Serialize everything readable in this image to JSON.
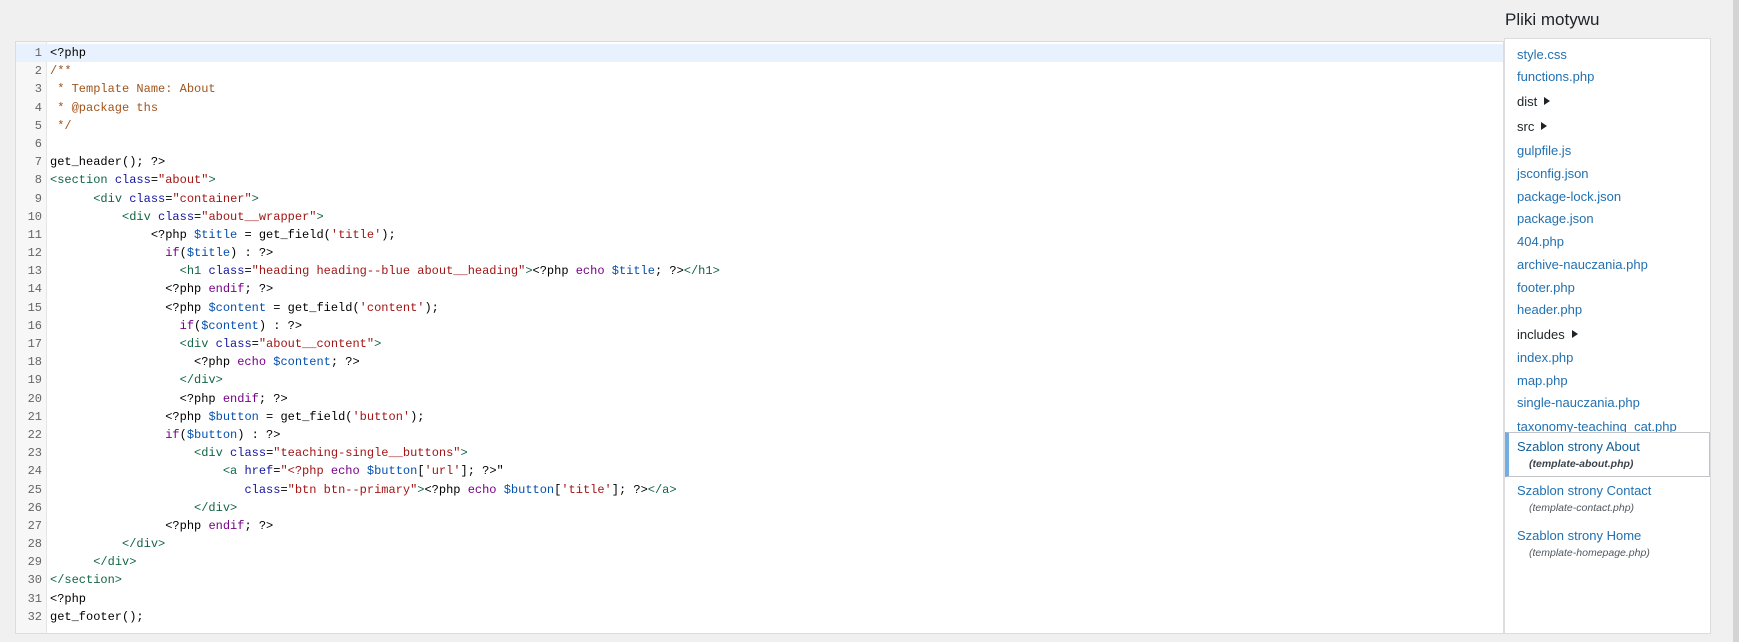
{
  "sidebar": {
    "title": "Pliki motywu",
    "items": [
      {
        "label": "style.css",
        "type": "file"
      },
      {
        "label": "functions.php",
        "type": "file"
      },
      {
        "label": "dist",
        "type": "folder"
      },
      {
        "label": "src",
        "type": "folder"
      },
      {
        "label": "gulpfile.js",
        "type": "file"
      },
      {
        "label": "jsconfig.json",
        "type": "file"
      },
      {
        "label": "package-lock.json",
        "type": "file"
      },
      {
        "label": "package.json",
        "type": "file"
      },
      {
        "label": "404.php",
        "type": "file"
      },
      {
        "label": "archive-nauczania.php",
        "type": "file"
      },
      {
        "label": "footer.php",
        "type": "file"
      },
      {
        "label": "header.php",
        "type": "file"
      },
      {
        "label": "includes",
        "type": "folder"
      },
      {
        "label": "index.php",
        "type": "file"
      },
      {
        "label": "map.php",
        "type": "file"
      },
      {
        "label": "single-nauczania.php",
        "type": "file"
      },
      {
        "label": "taxonomy-teaching_cat.php",
        "type": "file"
      }
    ],
    "templates": [
      {
        "name": "Szablon strony About",
        "file": "(template-about.php)",
        "current": true
      },
      {
        "name": "Szablon strony Contact",
        "file": "(template-contact.php)",
        "current": false
      },
      {
        "name": "Szablon strony Home",
        "file": "(template-homepage.php)",
        "current": false
      }
    ]
  },
  "editor": {
    "active_line": 1,
    "lines": [
      [
        [
          "p",
          "<?php"
        ]
      ],
      [
        [
          "c",
          "/**"
        ]
      ],
      [
        [
          "c",
          " * Template Name: About"
        ]
      ],
      [
        [
          "c",
          " * @package ths"
        ]
      ],
      [
        [
          "c",
          " */"
        ]
      ],
      [],
      [
        [
          "p",
          "get_header(); ?>"
        ]
      ],
      [
        [
          "g",
          "<section "
        ],
        [
          "a",
          "class"
        ],
        [
          "p",
          "="
        ],
        [
          "s",
          "\"about\""
        ],
        [
          "g",
          ">"
        ]
      ],
      [
        [
          "p",
          "      "
        ],
        [
          "g",
          "<div "
        ],
        [
          "a",
          "class"
        ],
        [
          "p",
          "="
        ],
        [
          "s",
          "\"container\""
        ],
        [
          "g",
          ">"
        ]
      ],
      [
        [
          "p",
          "          "
        ],
        [
          "g",
          "<div "
        ],
        [
          "a",
          "class"
        ],
        [
          "p",
          "="
        ],
        [
          "s",
          "\"about__wrapper\""
        ],
        [
          "g",
          ">"
        ]
      ],
      [
        [
          "p",
          "              <?php "
        ],
        [
          "v",
          "$title"
        ],
        [
          "p",
          " = get_field("
        ],
        [
          "s",
          "'title'"
        ],
        [
          "p",
          ");"
        ]
      ],
      [
        [
          "p",
          "                "
        ],
        [
          "k",
          "if"
        ],
        [
          "p",
          "("
        ],
        [
          "v",
          "$title"
        ],
        [
          "p",
          ") : ?>"
        ]
      ],
      [
        [
          "p",
          "                  "
        ],
        [
          "g",
          "<h1 "
        ],
        [
          "a",
          "class"
        ],
        [
          "p",
          "="
        ],
        [
          "s",
          "\"heading heading--blue about__heading\""
        ],
        [
          "g",
          ">"
        ],
        [
          "p",
          "<?php "
        ],
        [
          "k",
          "echo"
        ],
        [
          "p",
          " "
        ],
        [
          "v",
          "$title"
        ],
        [
          "p",
          "; ?>"
        ],
        [
          "g",
          "</h1>"
        ]
      ],
      [
        [
          "p",
          "                <?php "
        ],
        [
          "k",
          "endif"
        ],
        [
          "p",
          "; ?>"
        ]
      ],
      [
        [
          "p",
          "                <?php "
        ],
        [
          "v",
          "$content"
        ],
        [
          "p",
          " = get_field("
        ],
        [
          "s",
          "'content'"
        ],
        [
          "p",
          ");"
        ]
      ],
      [
        [
          "p",
          "                  "
        ],
        [
          "k",
          "if"
        ],
        [
          "p",
          "("
        ],
        [
          "v",
          "$content"
        ],
        [
          "p",
          ") : ?>"
        ]
      ],
      [
        [
          "p",
          "                  "
        ],
        [
          "g",
          "<div "
        ],
        [
          "a",
          "class"
        ],
        [
          "p",
          "="
        ],
        [
          "s",
          "\"about__content\""
        ],
        [
          "g",
          ">"
        ]
      ],
      [
        [
          "p",
          "                    <?php "
        ],
        [
          "k",
          "echo"
        ],
        [
          "p",
          " "
        ],
        [
          "v",
          "$content"
        ],
        [
          "p",
          "; ?>"
        ]
      ],
      [
        [
          "p",
          "                  "
        ],
        [
          "g",
          "</div>"
        ]
      ],
      [
        [
          "p",
          "                  <?php "
        ],
        [
          "k",
          "endif"
        ],
        [
          "p",
          "; ?>"
        ]
      ],
      [
        [
          "p",
          "                <?php "
        ],
        [
          "v",
          "$button"
        ],
        [
          "p",
          " = get_field("
        ],
        [
          "s",
          "'button'"
        ],
        [
          "p",
          ");"
        ]
      ],
      [
        [
          "p",
          "                "
        ],
        [
          "k",
          "if"
        ],
        [
          "p",
          "("
        ],
        [
          "v",
          "$button"
        ],
        [
          "p",
          ") : ?>"
        ]
      ],
      [
        [
          "p",
          "                    "
        ],
        [
          "g",
          "<div "
        ],
        [
          "a",
          "class"
        ],
        [
          "p",
          "="
        ],
        [
          "s",
          "\"teaching-single__buttons\""
        ],
        [
          "g",
          ">"
        ]
      ],
      [
        [
          "p",
          "                        "
        ],
        [
          "g",
          "<a "
        ],
        [
          "a",
          "href"
        ],
        [
          "p",
          "="
        ],
        [
          "s",
          "\"<?php "
        ],
        [
          "k",
          "echo"
        ],
        [
          "p",
          " "
        ],
        [
          "v",
          "$button"
        ],
        [
          "p",
          "["
        ],
        [
          "s",
          "'url'"
        ],
        [
          "p",
          "]; ?>\""
        ]
      ],
      [
        [
          "p",
          "                           "
        ],
        [
          "a",
          "class"
        ],
        [
          "p",
          "="
        ],
        [
          "s",
          "\"btn btn--primary\""
        ],
        [
          "g",
          ">"
        ],
        [
          "p",
          "<?php "
        ],
        [
          "k",
          "echo"
        ],
        [
          "p",
          " "
        ],
        [
          "v",
          "$button"
        ],
        [
          "p",
          "["
        ],
        [
          "s",
          "'title'"
        ],
        [
          "p",
          "]; ?>"
        ],
        [
          "g",
          "</a>"
        ]
      ],
      [
        [
          "p",
          "                    "
        ],
        [
          "g",
          "</div>"
        ]
      ],
      [
        [
          "p",
          "                <?php "
        ],
        [
          "k",
          "endif"
        ],
        [
          "p",
          "; ?>"
        ]
      ],
      [
        [
          "p",
          "          "
        ],
        [
          "g",
          "</div>"
        ]
      ],
      [
        [
          "p",
          "      "
        ],
        [
          "g",
          "</div>"
        ]
      ],
      [
        [
          "g",
          "</section>"
        ]
      ],
      [
        [
          "p",
          "<?php"
        ]
      ],
      [
        [
          "p",
          "get_footer();"
        ]
      ]
    ]
  }
}
